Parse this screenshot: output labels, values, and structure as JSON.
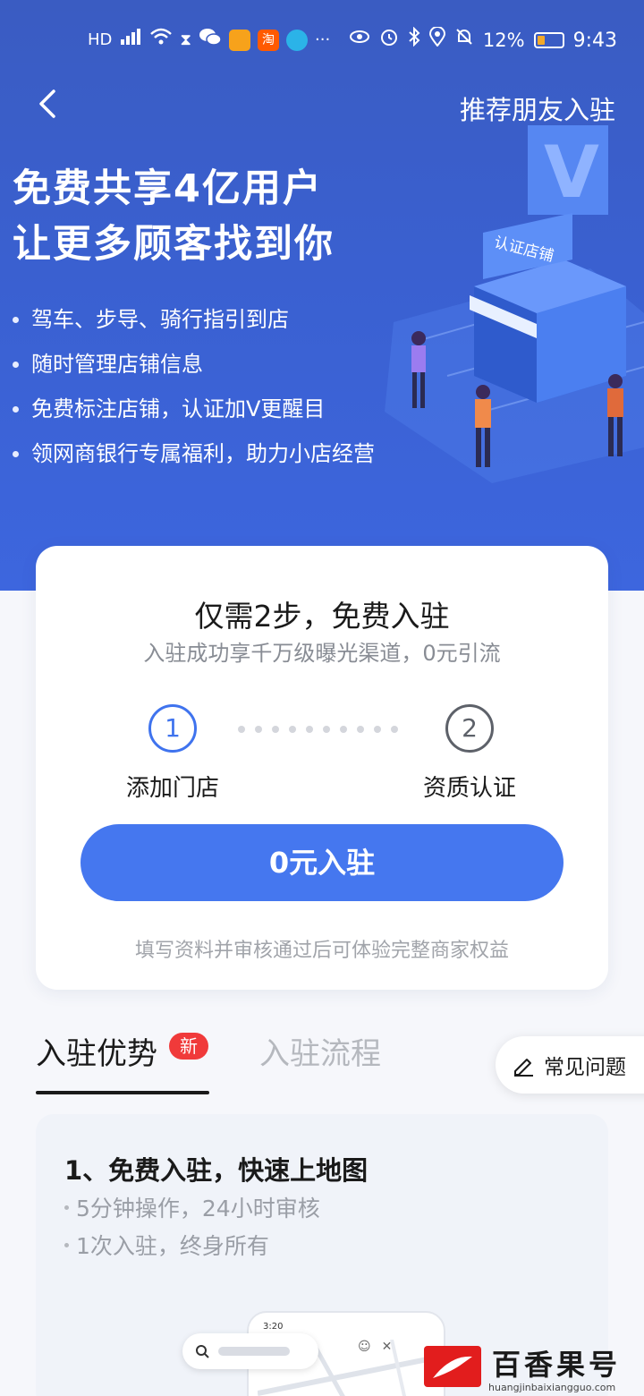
{
  "status_bar": {
    "left_icons": [
      "hd-icon",
      "4g-icon",
      "signal-icon",
      "wifi-icon",
      "hourglass-icon",
      "wechat-icon",
      "video-app-icon",
      "taobao-app-icon",
      "browser-app-icon",
      "more-icon"
    ],
    "taobao_glyph": "淘",
    "more": "···",
    "battery": "12%",
    "time": "9:43"
  },
  "header": {
    "recommend_link": "推荐朋友入驻"
  },
  "hero": {
    "title_line1": "免费共享4亿用户",
    "title_line2": "让更多顾客找到你",
    "bullets": [
      "驾车、步导、骑行指引到店",
      "随时管理店铺信息",
      "免费标注店铺，认证加V更醒目",
      "领网商银行专属福利，助力小店经营"
    ],
    "illustration_sign": "认证店铺",
    "illustration_badge": "V"
  },
  "card": {
    "title": "仅需2步，免费入驻",
    "subtitle": "入驻成功享千万级曝光渠道，0元引流",
    "step1_number": "1",
    "step1_label": "添加门店",
    "step2_number": "2",
    "step2_label": "资质认证",
    "join_button": "0元入驻",
    "note": "填写资料并审核通过后可体验完整商家权益"
  },
  "tabs": {
    "advantages": "入驻优势",
    "new_badge": "新",
    "process": "入驻流程",
    "faq": "常见问题"
  },
  "advantage": {
    "title": "1、免费入驻，快速上地图",
    "items": [
      "5分钟操作，24小时审核",
      "1次入驻，终身所有"
    ]
  },
  "phone_mock": {
    "time": "3:20"
  },
  "watermark": {
    "name": "百香果号",
    "url": "huangjinbaixiangguo.com"
  },
  "colors": {
    "hero_bg": "#3a60d0",
    "accent": "#4577ef",
    "badge_red": "#f03a3a"
  }
}
